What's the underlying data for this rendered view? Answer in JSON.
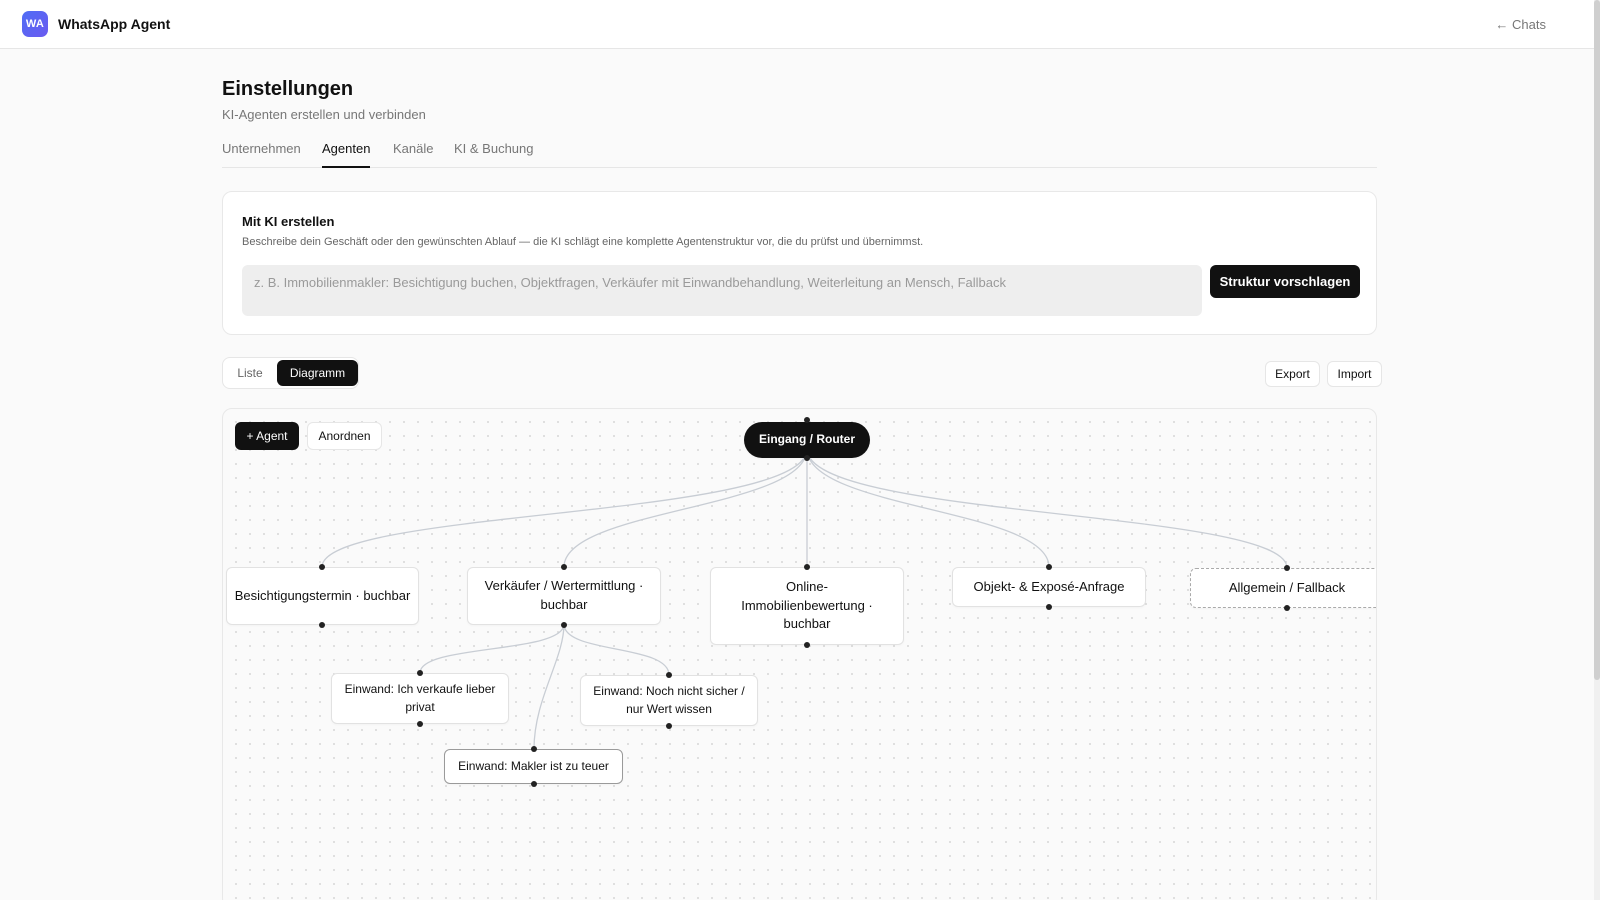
{
  "app": {
    "logo": "WA",
    "title": "WhatsApp Agent",
    "back_link": "← Chats"
  },
  "header": {
    "title": "Einstellungen",
    "subtitle": "KI-Agenten erstellen und verbinden"
  },
  "tabs": [
    {
      "label": "Unternehmen",
      "active": false
    },
    {
      "label": "Agenten",
      "active": true
    },
    {
      "label": "Kanäle",
      "active": false
    },
    {
      "label": "KI & Buchung",
      "active": false
    }
  ],
  "ai_card": {
    "title": "Mit KI erstellen",
    "description": "Beschreibe dein Geschäft oder den gewünschten Ablauf — die KI schlägt eine komplette Agentenstruktur vor, die du prüfst und übernimmst.",
    "input_value": "",
    "input_placeholder": "z. B. Immobilienmakler: Besichtigung buchen, Objektfragen, Verkäufer mit Einwandbehandlung, Weiterleitung an Mensch, Fallback",
    "submit_label": "Struktur vorschlagen"
  },
  "view_toggle": {
    "list_label": "Liste",
    "diagram_label": "Diagramm",
    "selected": "Diagramm"
  },
  "actions": {
    "export_label": "Export",
    "import_label": "Import"
  },
  "canvas": {
    "add_agent_label": "+ Agent",
    "arrange_label": "Anordnen",
    "nodes": {
      "router": "Eingang / Router",
      "besichtigung": "Besichtigungstermin · buchbar",
      "verkaeufer": "Verkäufer / Wertermittlung · buchbar",
      "online": "Online-Immobilienbewertung · buchbar",
      "objekt": "Objekt- & Exposé-Anfrage",
      "fallback": "Allgemein / Fallback",
      "einwand_privat": "Einwand: Ich verkaufe lieber privat",
      "einwand_unsicher": "Einwand: Noch nicht sicher / nur Wert wissen",
      "einwand_teuer": "Einwand: Makler ist zu teuer"
    }
  },
  "colors": {
    "primary": "#111111",
    "logo_gradient_start": "#4f6df5",
    "logo_gradient_end": "#6b5bf0",
    "edge": "#c8cdd4"
  }
}
